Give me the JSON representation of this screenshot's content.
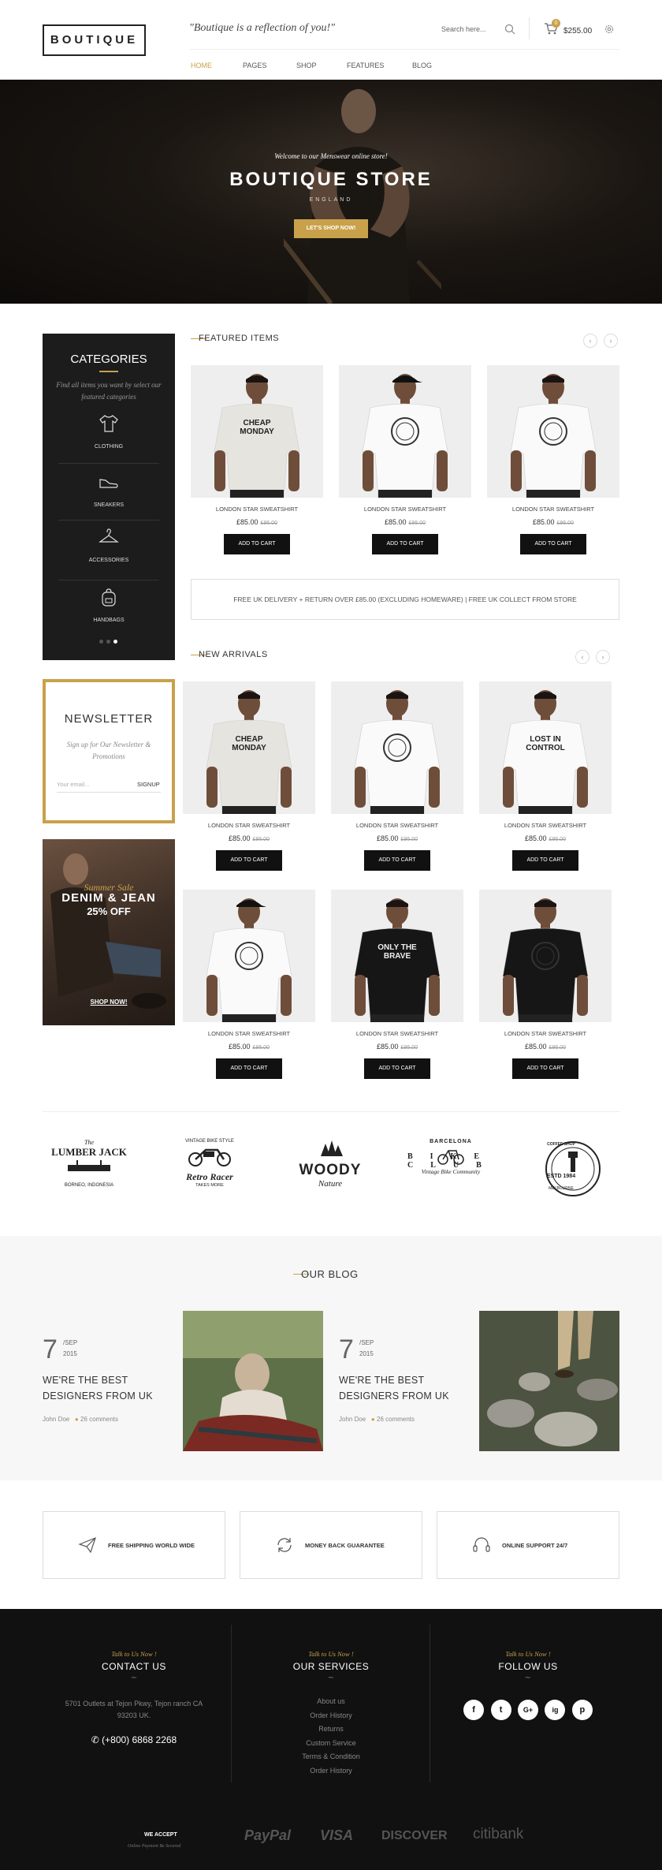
{
  "header": {
    "logo": "BOUTIQUE",
    "tagline": "\"Boutique is a reflection of you!\"",
    "search_placeholder": "Search here...",
    "cart_count": "0",
    "cart_total": "$255.00",
    "nav": [
      "HOME",
      "PAGES",
      "SHOP",
      "FEATURES",
      "BLOG"
    ]
  },
  "hero": {
    "welcome": "Welcome to our Menswear online store!",
    "title": "BOUTIQUE STORE",
    "subtitle": "ENGLAND",
    "button": "LET'S SHOP NOW!"
  },
  "categories": {
    "title": "CATEGORIES",
    "description": "Find all items you want by select our featured categories",
    "items": [
      "CLOTHING",
      "SNEAKERS",
      "ACCESSORIES",
      "HANDBAGS"
    ]
  },
  "featured": {
    "title": "FEATURED ITEMS",
    "products": [
      {
        "name": "LONDON STAR SWEATSHIRT",
        "price": "£85.00",
        "old_price": "£95.00",
        "button": "ADD TO CART",
        "print": "CHEAP MONDAY"
      },
      {
        "name": "LONDON STAR SWEATSHIRT",
        "price": "£85.00",
        "old_price": "£95.00",
        "button": "ADD TO CART",
        "print": ""
      },
      {
        "name": "LONDON STAR SWEATSHIRT",
        "price": "£85.00",
        "old_price": "£95.00",
        "button": "ADD TO CART",
        "print": ""
      }
    ]
  },
  "delivery_banner": "FREE UK DELIVERY + RETURN OVER £85.00 (EXCLUDING HOMEWARE) | FREE UK COLLECT FROM STORE",
  "new_arrivals": {
    "title": "NEW ARRIVALS",
    "products": [
      {
        "name": "LONDON STAR SWEATSHIRT",
        "price": "£85.00",
        "old_price": "£95.00",
        "button": "ADD TO CART",
        "print": "CHEAP MONDAY"
      },
      {
        "name": "LONDON STAR SWEATSHIRT",
        "price": "£85.00",
        "old_price": "£95.00",
        "button": "ADD TO CART",
        "print": ""
      },
      {
        "name": "LONDON STAR SWEATSHIRT",
        "price": "£85.00",
        "old_price": "£95.00",
        "button": "ADD TO CART",
        "print": "LOST IN CONTROL"
      },
      {
        "name": "LONDON STAR SWEATSHIRT",
        "price": "£85.00",
        "old_price": "£95.00",
        "button": "ADD TO CART",
        "print": ""
      },
      {
        "name": "LONDON STAR SWEATSHIRT",
        "price": "£85.00",
        "old_price": "£95.00",
        "button": "ADD TO CART",
        "print": "ONLY THE BRAVE"
      },
      {
        "name": "LONDON STAR SWEATSHIRT",
        "price": "£85.00",
        "old_price": "£95.00",
        "button": "ADD TO CART",
        "print": ""
      }
    ]
  },
  "newsletter": {
    "title": "NEWSLETTER",
    "description": "Sign up for Our Newsletter & Promotions",
    "placeholder": "Your email...",
    "button": "SIGNUP"
  },
  "promo": {
    "script": "Summer Sale",
    "title": "DENIM & JEAN",
    "discount": "25% OFF",
    "link": "SHOP NOW!"
  },
  "brands": [
    {
      "top": "The",
      "main": "LUMBER JACK",
      "sub": "BORNEO, INDONESIA"
    },
    {
      "top": "VINTAGE BIKE STYLE",
      "main": "Retro Racer",
      "sub": "TAKES MORE"
    },
    {
      "top": "",
      "main": "WOODY",
      "sub": "Nature"
    },
    {
      "top": "BARCELONA",
      "main": "BIKE CLUB",
      "sub": "Vintage Bike Community"
    },
    {
      "top": "COFFEE SHOP",
      "main": "ESTD 1984",
      "sub": "MELBOURNE"
    }
  ],
  "blog": {
    "title": "OUR BLOG",
    "posts": [
      {
        "day": "7",
        "month": "/SEP",
        "year": "2015",
        "title": "WE'RE THE BEST DESIGNERS FROM UK",
        "author": "John Doe",
        "comments": "26 comments"
      },
      {
        "day": "7",
        "month": "/SEP",
        "year": "2015",
        "title": "WE'RE THE BEST DESIGNERS FROM UK",
        "author": "John Doe",
        "comments": "26 comments"
      }
    ]
  },
  "features": [
    "FREE SHIPPING WORLD WIDE",
    "MONEY BACK GUARANTEE",
    "ONLINE SUPPORT 24/7"
  ],
  "footer": {
    "contact": {
      "script": "Talk to Us Now !",
      "title": "CONTACT US",
      "address": "5701 Outlets at Tejon Pkwy, Tejon ranch CA 93203 UK.",
      "phone": "(+800) 6868 2268"
    },
    "services": {
      "script": "Talk to Us Now !",
      "title": "OUR SERVICES",
      "links": [
        "About us",
        "Order History",
        "Returns",
        "Custom Service",
        "Terms & Condition",
        "Order History"
      ]
    },
    "follow": {
      "script": "Talk to Us Now !",
      "title": "FOLLOW US",
      "social": [
        "f",
        "t",
        "G+",
        "ig",
        "p"
      ]
    },
    "payment_label": "WE ACCEPT",
    "payment_sub": "Online Payment Be Secured",
    "payments": [
      "PayPal",
      "VISA",
      "DISCOVER",
      "citibank"
    ]
  },
  "colors": {
    "accent": "#c9a14a",
    "dark": "#111111",
    "footer": "#111111"
  }
}
